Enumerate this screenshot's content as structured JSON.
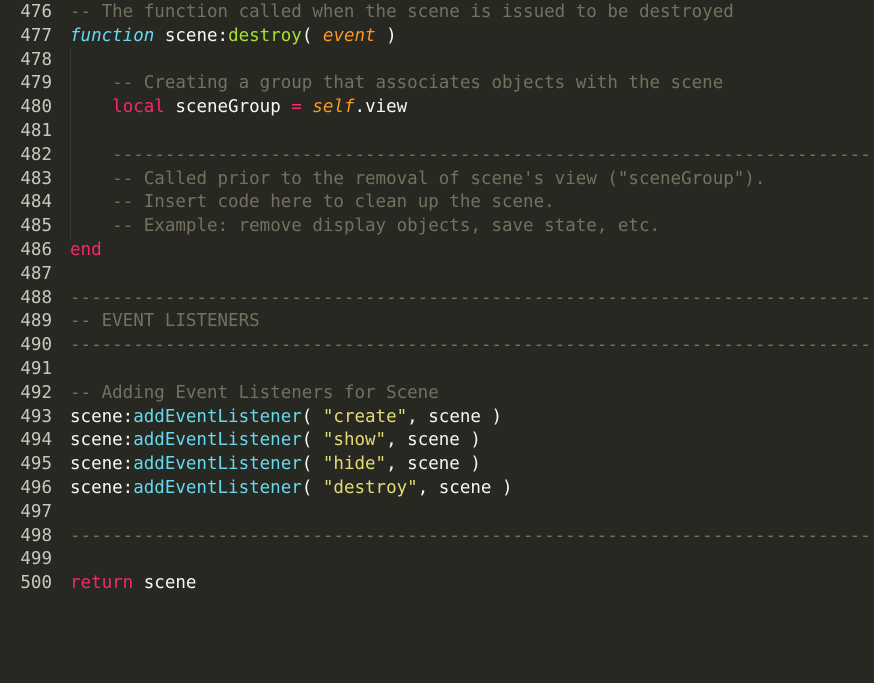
{
  "editor": {
    "theme_colors": {
      "background": "#272822",
      "comment": "#75715e",
      "keyword": "#f92672",
      "storage": "#66d9ef",
      "function": "#a6e22e",
      "parameter": "#fd971f",
      "string": "#e6db74",
      "plain": "#f8f8f2",
      "gutter": "#c8c8c0"
    },
    "lines": [
      {
        "n": "476",
        "tokens": [
          {
            "t": "comment",
            "v": "-- The function called when the scene is issued to be destroyed"
          }
        ]
      },
      {
        "n": "477",
        "tokens": [
          {
            "t": "storage",
            "v": "function"
          },
          {
            "t": "plain",
            "v": " scene:"
          },
          {
            "t": "func",
            "v": "destroy"
          },
          {
            "t": "plain",
            "v": "( "
          },
          {
            "t": "param",
            "v": "event"
          },
          {
            "t": "plain",
            "v": " )"
          }
        ]
      },
      {
        "n": "478",
        "tokens": []
      },
      {
        "n": "479",
        "tokens": [
          {
            "t": "plain",
            "v": "    "
          },
          {
            "t": "comment",
            "v": "-- Creating a group that associates objects with the scene"
          }
        ]
      },
      {
        "n": "480",
        "tokens": [
          {
            "t": "plain",
            "v": "    "
          },
          {
            "t": "keyword",
            "v": "local"
          },
          {
            "t": "plain",
            "v": " sceneGroup "
          },
          {
            "t": "operator",
            "v": "="
          },
          {
            "t": "plain",
            "v": " "
          },
          {
            "t": "self",
            "v": "self"
          },
          {
            "t": "plain",
            "v": ".view"
          }
        ]
      },
      {
        "n": "481",
        "tokens": []
      },
      {
        "n": "482",
        "tokens": [
          {
            "t": "plain",
            "v": "    "
          },
          {
            "t": "comment",
            "v": "-----------------------------------------------------------------------------------"
          }
        ]
      },
      {
        "n": "483",
        "tokens": [
          {
            "t": "plain",
            "v": "    "
          },
          {
            "t": "comment",
            "v": "-- Called prior to the removal of scene's view (\"sceneGroup\")."
          }
        ]
      },
      {
        "n": "484",
        "tokens": [
          {
            "t": "plain",
            "v": "    "
          },
          {
            "t": "comment",
            "v": "-- Insert code here to clean up the scene."
          }
        ]
      },
      {
        "n": "485",
        "tokens": [
          {
            "t": "plain",
            "v": "    "
          },
          {
            "t": "comment",
            "v": "-- Example: remove display objects, save state, etc."
          }
        ]
      },
      {
        "n": "486",
        "tokens": [
          {
            "t": "keyword",
            "v": "end"
          }
        ]
      },
      {
        "n": "487",
        "tokens": []
      },
      {
        "n": "488",
        "tokens": [
          {
            "t": "comment",
            "v": "-----------------------------------------------------------------------------------------"
          }
        ]
      },
      {
        "n": "489",
        "tokens": [
          {
            "t": "comment",
            "v": "-- EVENT LISTENERS"
          }
        ]
      },
      {
        "n": "490",
        "tokens": [
          {
            "t": "comment",
            "v": "-----------------------------------------------------------------------------------------"
          }
        ]
      },
      {
        "n": "491",
        "tokens": []
      },
      {
        "n": "492",
        "tokens": [
          {
            "t": "comment",
            "v": "-- Adding Event Listeners for Scene"
          }
        ]
      },
      {
        "n": "493",
        "tokens": [
          {
            "t": "plain",
            "v": "scene:"
          },
          {
            "t": "support",
            "v": "addEventListener"
          },
          {
            "t": "plain",
            "v": "( "
          },
          {
            "t": "string",
            "v": "\"create\""
          },
          {
            "t": "plain",
            "v": ", scene )"
          }
        ]
      },
      {
        "n": "494",
        "tokens": [
          {
            "t": "plain",
            "v": "scene:"
          },
          {
            "t": "support",
            "v": "addEventListener"
          },
          {
            "t": "plain",
            "v": "( "
          },
          {
            "t": "string",
            "v": "\"show\""
          },
          {
            "t": "plain",
            "v": ", scene )"
          }
        ]
      },
      {
        "n": "495",
        "tokens": [
          {
            "t": "plain",
            "v": "scene:"
          },
          {
            "t": "support",
            "v": "addEventListener"
          },
          {
            "t": "plain",
            "v": "( "
          },
          {
            "t": "string",
            "v": "\"hide\""
          },
          {
            "t": "plain",
            "v": ", scene )"
          }
        ]
      },
      {
        "n": "496",
        "tokens": [
          {
            "t": "plain",
            "v": "scene:"
          },
          {
            "t": "support",
            "v": "addEventListener"
          },
          {
            "t": "plain",
            "v": "( "
          },
          {
            "t": "string",
            "v": "\"destroy\""
          },
          {
            "t": "plain",
            "v": ", scene )"
          }
        ]
      },
      {
        "n": "497",
        "tokens": []
      },
      {
        "n": "498",
        "tokens": [
          {
            "t": "comment",
            "v": "-----------------------------------------------------------------------------------------"
          }
        ]
      },
      {
        "n": "499",
        "tokens": []
      },
      {
        "n": "500",
        "tokens": [
          {
            "t": "keyword",
            "v": "return"
          },
          {
            "t": "plain",
            "v": " scene"
          }
        ]
      }
    ]
  }
}
